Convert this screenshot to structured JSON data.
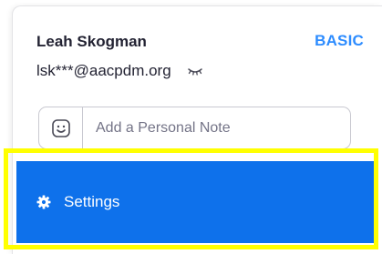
{
  "profile": {
    "name": "Leah Skogman",
    "plan": "BASIC",
    "email": "lsk***@aacpdm.org"
  },
  "note": {
    "placeholder": "Add a Personal Note",
    "value": ""
  },
  "menu": {
    "settings_label": "Settings"
  },
  "icons": {
    "email_visibility": "eye-hidden-icon",
    "note_emoji": "smiley-icon",
    "settings": "gear-icon"
  },
  "colors": {
    "accent": "#0e71eb",
    "plan_badge": "#2d8cff",
    "highlight": "#ffff00"
  }
}
